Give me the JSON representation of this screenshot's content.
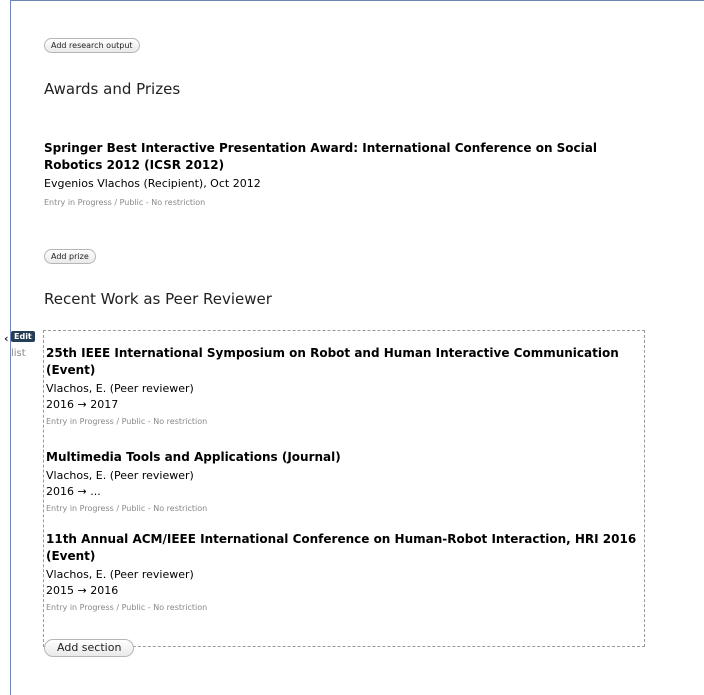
{
  "toolbar": {
    "add_output": "Add research output",
    "add_prize": "Add prize",
    "add_section": "Add section"
  },
  "awards": {
    "title": "Awards and Prizes",
    "items": [
      {
        "title": "Springer Best Interactive Presentation Award: International Conference on Social Robotics 2012 (ICSR 2012)",
        "subtitle": "Evgenios Vlachos (Recipient), Oct 2012",
        "status": "Entry in Progress / Public - No restriction"
      }
    ]
  },
  "peer": {
    "title": "Recent Work as Peer Reviewer",
    "edit_label": "Edit",
    "list_label": "list",
    "arrow": "‹",
    "items": [
      {
        "title": "25th IEEE International Symposium on Robot and Human Interactive Communication (Event)",
        "role": "Vlachos, E. (Peer reviewer)",
        "dates": "2016 → 2017",
        "status": "Entry in Progress / Public - No restriction"
      },
      {
        "title": "Multimedia Tools and Applications (Journal)",
        "role": "Vlachos, E. (Peer reviewer)",
        "dates": "2016 → ...",
        "status": "Entry in Progress / Public - No restriction"
      },
      {
        "title": "11th Annual ACM/IEEE International Conference on Human-Robot Interaction, HRI 2016 (Event)",
        "role": "Vlachos, E. (Peer reviewer)",
        "dates": "2015 → 2016",
        "status": "Entry in Progress / Public - No restriction"
      }
    ]
  }
}
